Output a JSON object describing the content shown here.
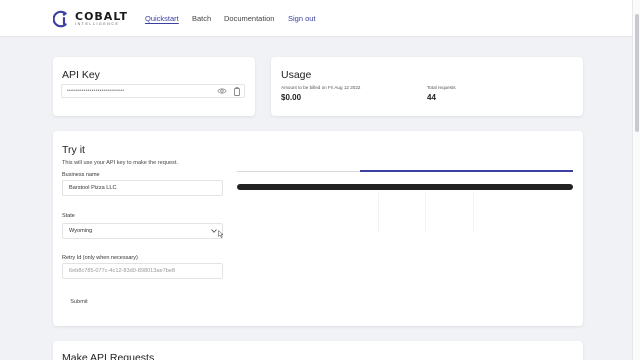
{
  "brand": {
    "name": "COBALT",
    "tagline": "INTELLIGENCE"
  },
  "nav": {
    "quickstart": "Quickstart",
    "batch": "Batch",
    "documentation": "Documentation",
    "signout": "Sign out"
  },
  "api_key": {
    "title": "API Key",
    "masked_value": "••••••••••••••••••••••••••••",
    "show_icon": "eye-icon",
    "copy_icon": "copy-icon"
  },
  "usage": {
    "title": "Usage",
    "billed_label": "Amount to be billed on Fri Aug 12 2022",
    "billed_value": "$0.00",
    "requests_label": "Total requests",
    "requests_value": "44"
  },
  "try_it": {
    "title": "Try it",
    "subtitle": "This will use your API key to make the request.",
    "business_label": "Business name",
    "business_value": "Barstool Pizza LLC",
    "state_label": "State",
    "state_value": "Wyoming",
    "retry_label": "Retry Id (only when necessary)",
    "retry_placeholder": "6eb8c785-077c-4c12-83d0-898013ae7be8",
    "submit_label": "Submit",
    "progress_fraction": 1.0
  },
  "make_requests": {
    "title": "Make API Requests"
  },
  "colors": {
    "accent": "#3a3fa0",
    "background": "#f1f2f6",
    "card": "#ffffff",
    "progress": "#222222"
  }
}
